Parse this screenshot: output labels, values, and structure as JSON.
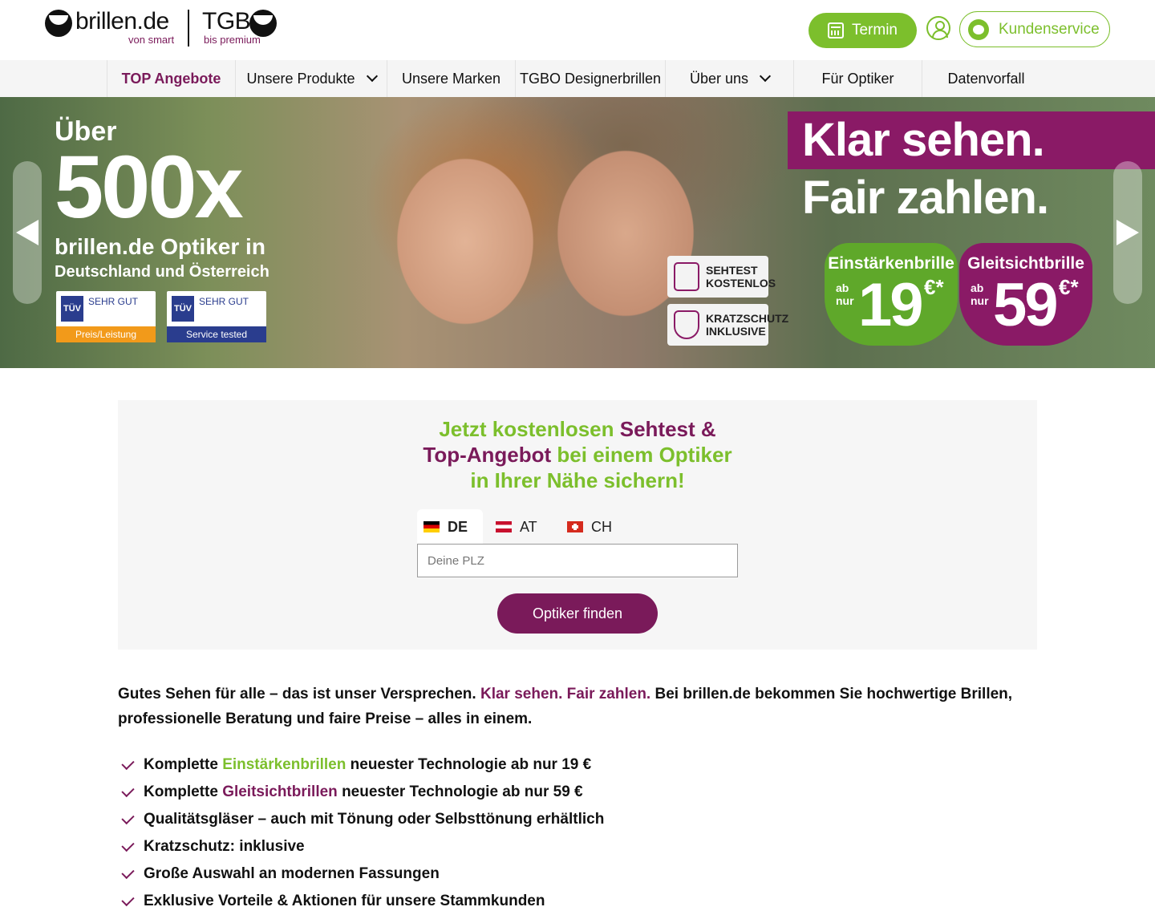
{
  "header": {
    "logo_brillen": "brillen.de",
    "logo_brillen_sub": "von smart",
    "logo_tgb": "TGB",
    "logo_tgb_sub": "bis premium",
    "termin_label": "Termin",
    "service_label": "Kundenservice"
  },
  "nav": {
    "items": [
      {
        "label": "TOP Angebote"
      },
      {
        "label": "Unsere Produkte"
      },
      {
        "label": "Unsere Marken"
      },
      {
        "label": "TGBO Designerbrillen"
      },
      {
        "label": "Über uns"
      },
      {
        "label": "Für Optiker"
      },
      {
        "label": "Datenvorfall"
      }
    ]
  },
  "hero": {
    "left_l1": "Über",
    "left_l2": "500x",
    "left_l3": "brillen.de Optiker in",
    "left_l4": "Deutschland und Österreich",
    "tuv": [
      {
        "logo": "TÜV SAARLAND",
        "title": "SEHR GUT",
        "bar": "Preis/Leistung",
        "color": "#f29a1a"
      },
      {
        "logo": "TÜV SAARLAND",
        "title": "SEHR GUT",
        "bar": "Service tested",
        "color": "#2a3d8e"
      }
    ],
    "headline_1": "Klar sehen.",
    "headline_2": "Fair zahlen.",
    "tag_sehtest": "SEHTEST KOSTENLOS",
    "tag_kratz": "KRATZSCHUTZ INKLUSIVE",
    "badge_1": {
      "title": "Einstärkenbrille",
      "ab": "ab nur",
      "price": "19",
      "cur": "€*"
    },
    "badge_2": {
      "title": "Gleitsichtbrille",
      "ab": "ab nur",
      "price": "59",
      "cur": "€*"
    }
  },
  "finder": {
    "title_part1": "Jetzt kostenlosen ",
    "title_part2": "Sehtest & Top-Angebot",
    "title_part3": " bei einem Optiker in Ihrer Nähe sichern!",
    "tabs": [
      {
        "label": "DE"
      },
      {
        "label": "AT"
      },
      {
        "label": "CH"
      }
    ],
    "plz_placeholder": "Deine PLZ",
    "button_label": "Optiker finden"
  },
  "intro": {
    "part1": "Gutes Sehen für alle – das ist unser Versprechen. ",
    "part2": "Klar sehen. Fair zahlen.",
    "part3": " Bei brillen.de bekommen Sie hochwertige Brillen, professionelle Beratung und faire Preise – alles in einem."
  },
  "features": {
    "f1_pre": "Komplette ",
    "f1_link": "Einstärkenbrillen",
    "f1_post": " neuester Technologie ab nur 19 €",
    "f2_pre": "Komplette ",
    "f2_link": "Gleitsichtbrillen",
    "f2_post": " neuester Technologie ab nur 59 €",
    "f3": "Qualitätsgläser – auch mit Tönung oder Selbsttönung erhältlich",
    "f4": "Kratzschutz: inklusive",
    "f5": "Große Auswahl an modernen Fassungen",
    "f6": "Exklusive Vorteile & Aktionen für unsere Stammkunden"
  },
  "colors": {
    "green": "#7cbf2c",
    "purple": "#7a1a5a"
  }
}
